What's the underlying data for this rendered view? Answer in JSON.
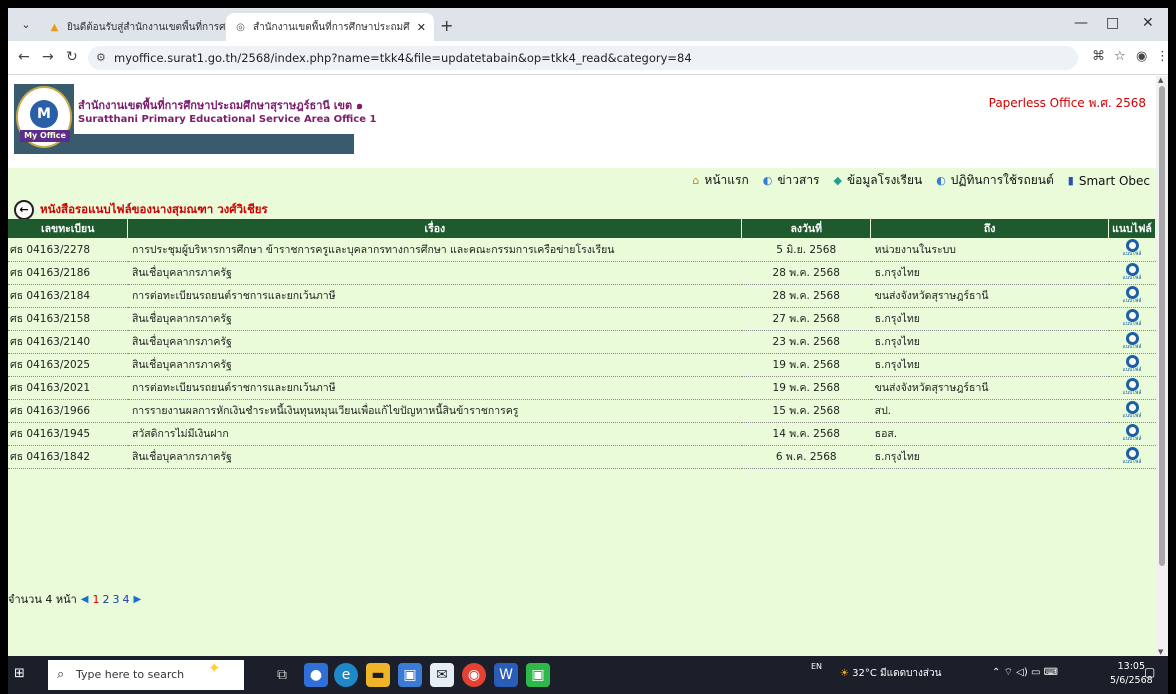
{
  "browser": {
    "tabs": [
      {
        "title": "ยินดีต้อนรับสู่สำนักงานเขตพื้นที่การศ",
        "active": false
      },
      {
        "title": "สำนักงานเขตพื้นที่การศึกษาประถมศึ",
        "active": true
      }
    ],
    "new_tab": "+",
    "url": "myoffice.surat1.go.th/2568/index.php?name=tkk4&file=updatetabain&op=tkk4_read&category=84",
    "minimize": "—",
    "maximize": "□",
    "close": "✕"
  },
  "header": {
    "org_name_th": "สำนักงานเขตพื้นที่การศึกษาประถมศึกษาสุราษฎร์ธานี เขต ๑",
    "org_name_en": "Suratthani Primary Educational Service Area Office 1",
    "logo_badge": "My Office",
    "paperless": "Paperless Office พ.ศ. 2568"
  },
  "nav": [
    {
      "label": "หน้าแรก",
      "icon": "home-icon"
    },
    {
      "label": "ข่าวสาร",
      "icon": "folder-icon"
    },
    {
      "label": "ข้อมูลโรงเรียน",
      "icon": "school-icon"
    },
    {
      "label": "ปฏิทินการใช้รถยนต์",
      "icon": "folder-icon"
    },
    {
      "label": "Smart Obec",
      "icon": "book-icon"
    }
  ],
  "section": {
    "title": "หนังสือรอแนบไฟล์ของนางสุมณฑา วงศ์วิเชียร"
  },
  "table": {
    "headers": [
      "เลขทะเบียน",
      "เรื่อง",
      "ลงวันที่",
      "ถึง",
      "แนบไฟล์"
    ],
    "attach_caption": "แนบไฟล์",
    "rows": [
      {
        "no": "ศธ 04163/2278",
        "subject": "การประชุมผู้บริหารการศึกษา ข้าราชการครูและบุคลากรทางการศึกษา และคณะกรรมการเครือข่ายโรงเรียน",
        "date": "5 มิ.ย. 2568",
        "to": "หน่วยงานในระบบ"
      },
      {
        "no": "ศธ 04163/2186",
        "subject": "สินเชื่อบุคลากรภาครัฐ",
        "date": "28 พ.ค. 2568",
        "to": "ธ.กรุงไทย"
      },
      {
        "no": "ศธ 04163/2184",
        "subject": "การต่อทะเบียนรถยนต์ราชการและยกเว้นภาษี",
        "date": "28 พ.ค. 2568",
        "to": "ขนส่งจังหวัดสุราษฎร์ธานี"
      },
      {
        "no": "ศธ 04163/2158",
        "subject": "สินเชื่อบุคลากรภาครัฐ",
        "date": "27 พ.ค. 2568",
        "to": "ธ.กรุงไทย"
      },
      {
        "no": "ศธ 04163/2140",
        "subject": "สินเชื่อบุคลากรภาครัฐ",
        "date": "23 พ.ค. 2568",
        "to": "ธ.กรุงไทย"
      },
      {
        "no": "ศธ 04163/2025",
        "subject": "สินเชื่อบุคลากรภาครัฐ",
        "date": "19 พ.ค. 2568",
        "to": "ธ.กรุงไทย"
      },
      {
        "no": "ศธ 04163/2021",
        "subject": "การต่อทะเบียนรถยนต์ราชการและยกเว้นภาษี",
        "date": "19 พ.ค. 2568",
        "to": "ขนส่งจังหวัดสุราษฎร์ธานี"
      },
      {
        "no": "ศธ 04163/1966",
        "subject": "การรายงานผลการหักเงินชำระหนี้เงินทุนหมุนเวียนเพื่อแก้ไขปัญหาหนี้สินข้าราชการครู",
        "date": "15 พ.ค. 2568",
        "to": "สป."
      },
      {
        "no": "ศธ 04163/1945",
        "subject": "สวัสดิการไม่มีเงินฝาก",
        "date": "14 พ.ค. 2568",
        "to": "ธอส."
      },
      {
        "no": "ศธ 04163/1842",
        "subject": "สินเชื่อบุคลากรภาครัฐ",
        "date": "6 พ.ค. 2568",
        "to": "ธ.กรุงไทย"
      }
    ]
  },
  "pager": {
    "label": "จำนวน 4 หน้า",
    "pages": [
      "1",
      "2",
      "3",
      "4"
    ],
    "current": "1"
  },
  "taskbar": {
    "search_placeholder": "Type here to search",
    "lang": "EN",
    "weather": "32°C มีแดดบางส่วน",
    "time": "13:05",
    "date": "5/6/2568"
  },
  "colors": {
    "page_bg": "#e9fbd9",
    "table_header": "#1f5a2f",
    "accent_red": "#d00000",
    "taskbar": "#1b1f2a"
  }
}
